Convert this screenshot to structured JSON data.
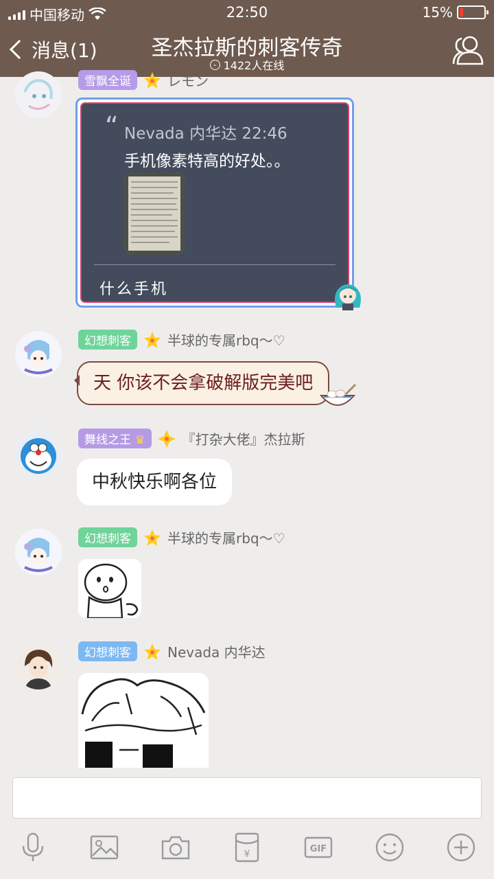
{
  "status": {
    "carrier": "中国移动",
    "time": "22:50",
    "battery": "15%"
  },
  "header": {
    "back_label": "消息(1)",
    "title": "圣杰拉斯的刺客传奇",
    "online": "1422人在线"
  },
  "messages": [
    {
      "tag": "雪飘全诞",
      "tag_color": "#b69be8",
      "name": "レモン",
      "quote": {
        "author": "Nevada 内华达 22:46",
        "text": "手机像素特高的好处。。",
        "reply": "什么手机"
      }
    },
    {
      "tag": "幻想刺客",
      "tag_color": "#6fd39a",
      "name": "半球的专属rbq～♡",
      "text": "天 你该不会拿破解版完美吧"
    },
    {
      "tag": "舞线之王",
      "tag_color": "#b59be6",
      "name": "『打杂大佬』杰拉斯",
      "text": "中秋快乐啊各位"
    },
    {
      "tag": "幻想刺客",
      "tag_color": "#6fd39a",
      "name": "半球的专属rbq～♡"
    },
    {
      "tag": "幻想刺客",
      "tag_color": "#7cb8f2",
      "name": "Nevada 内华达"
    }
  ],
  "input": {
    "placeholder": ""
  },
  "toolbar": [
    "microphone-icon",
    "image-icon",
    "camera-icon",
    "red-packet-icon",
    "gif-icon",
    "emoji-icon",
    "plus-icon"
  ],
  "colors": {
    "header": "#6e5a4f",
    "background": "#efedec",
    "battery_low": "#ff3b30"
  }
}
